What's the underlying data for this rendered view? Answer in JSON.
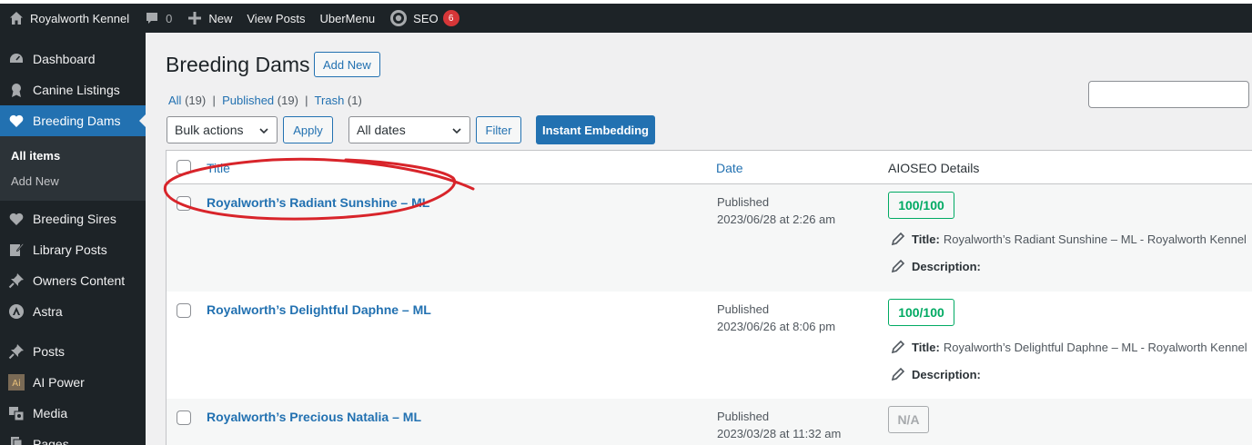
{
  "admin_bar": {
    "site_name": "Royalworth Kennel",
    "comments_count": "0",
    "new_label": "New",
    "view_posts_label": "View Posts",
    "ubermenu_label": "UberMenu",
    "seo_label": "SEO",
    "seo_badge": "6"
  },
  "sidebar": {
    "items": [
      {
        "label": "Dashboard",
        "icon": "dashboard-icon"
      },
      {
        "label": "Canine Listings",
        "icon": "award-icon"
      },
      {
        "label": "Breeding Dams",
        "icon": "heart-icon",
        "active": true
      },
      {
        "label": "Breeding Sires",
        "icon": "heart-icon"
      },
      {
        "label": "Library Posts",
        "icon": "edit-page-icon"
      },
      {
        "label": "Owners Content",
        "icon": "pin-icon"
      },
      {
        "label": "Astra",
        "icon": "astra-icon"
      },
      {
        "label": "Posts",
        "icon": "pin-icon"
      },
      {
        "label": "AI Power",
        "icon": "ai-power-icon"
      },
      {
        "label": "Media",
        "icon": "media-icon"
      },
      {
        "label": "Pages",
        "icon": "pages-icon"
      }
    ],
    "submenu": {
      "all_items": "All items",
      "add_new": "Add New"
    }
  },
  "page": {
    "title": "Breeding Dams",
    "add_new": "Add New",
    "views": {
      "all": "All",
      "all_count": "(19)",
      "published": "Published",
      "published_count": "(19)",
      "trash": "Trash",
      "trash_count": "(1)",
      "separator": "|"
    }
  },
  "toolbar": {
    "bulk_actions": "Bulk actions",
    "apply": "Apply",
    "dates": "All dates",
    "filter": "Filter",
    "instant_embedding": "Instant Embedding"
  },
  "table": {
    "columns": {
      "title": "Title",
      "date": "Date",
      "aioseo": "AIOSEO Details"
    },
    "rows": [
      {
        "title": "Royalworth’s Radiant Sunshine – ML",
        "status": "Published",
        "date": "2023/06/28 at 2:26 am",
        "score": "100/100",
        "seo_title_label": "Title:",
        "seo_title": "Royalworth’s Radiant Sunshine – ML - Royalworth Kennel",
        "description_label": "Description:"
      },
      {
        "title": "Royalworth’s Delightful Daphne – ML",
        "status": "Published",
        "date": "2023/06/26 at 8:06 pm",
        "score": "100/100",
        "seo_title_label": "Title:",
        "seo_title": "Royalworth’s Delightful Daphne – ML - Royalworth Kennel",
        "description_label": "Description:"
      },
      {
        "title": "Royalworth’s Precious Natalia – ML",
        "status": "Published",
        "date": "2023/03/28 at 11:32 am",
        "score": "N/A"
      }
    ]
  },
  "colors": {
    "accent": "#2271b1",
    "admin_dark": "#1d2327",
    "good_score": "#00aa63",
    "annotation": "#d8242a"
  }
}
